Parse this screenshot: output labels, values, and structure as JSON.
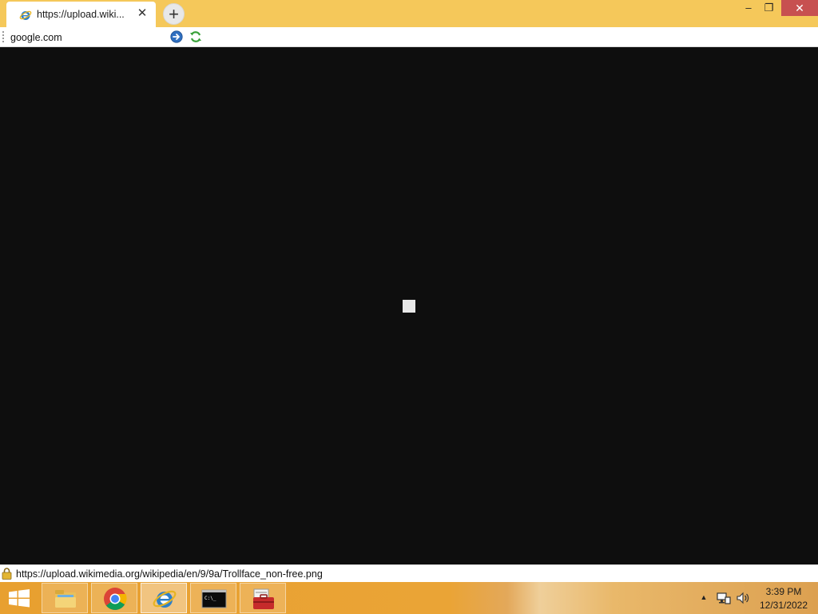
{
  "browser": {
    "tab": {
      "title": "https://upload.wiki...",
      "icon": "ie-icon",
      "close_label": "✕"
    },
    "new_tab_label": "+",
    "window_controls": {
      "minimize": "–",
      "restore": "❐",
      "close": "✕"
    },
    "address_bar": {
      "value": "google.com",
      "go_icon": "go-arrow-icon",
      "refresh_icon": "refresh-icon"
    },
    "status_bar": {
      "url": "https://upload.wikimedia.org/wikipedia/en/9/9a/Trollface_non-free.png",
      "icon": "lock-icon"
    }
  },
  "taskbar": {
    "start_icon": "windows-logo-icon",
    "items": [
      {
        "name": "file-explorer",
        "icon": "folder-icon",
        "active": false
      },
      {
        "name": "chrome",
        "icon": "chrome-icon",
        "active": false
      },
      {
        "name": "internet-explorer",
        "icon": "ie-icon",
        "active": true
      },
      {
        "name": "command-prompt",
        "icon": "cmd-icon",
        "active": false
      },
      {
        "name": "toolbox",
        "icon": "toolbox-icon",
        "active": false
      }
    ],
    "tray": {
      "chevron": "▲",
      "network_icon": "network-icon",
      "volume_icon": "volume-icon",
      "time": "3:39 PM",
      "date": "12/31/2022"
    }
  },
  "colors": {
    "titlebar": "#f5c85a",
    "content_background": "#0e0e0e",
    "close_button": "#c75050",
    "taskbar": "#eaa436"
  }
}
